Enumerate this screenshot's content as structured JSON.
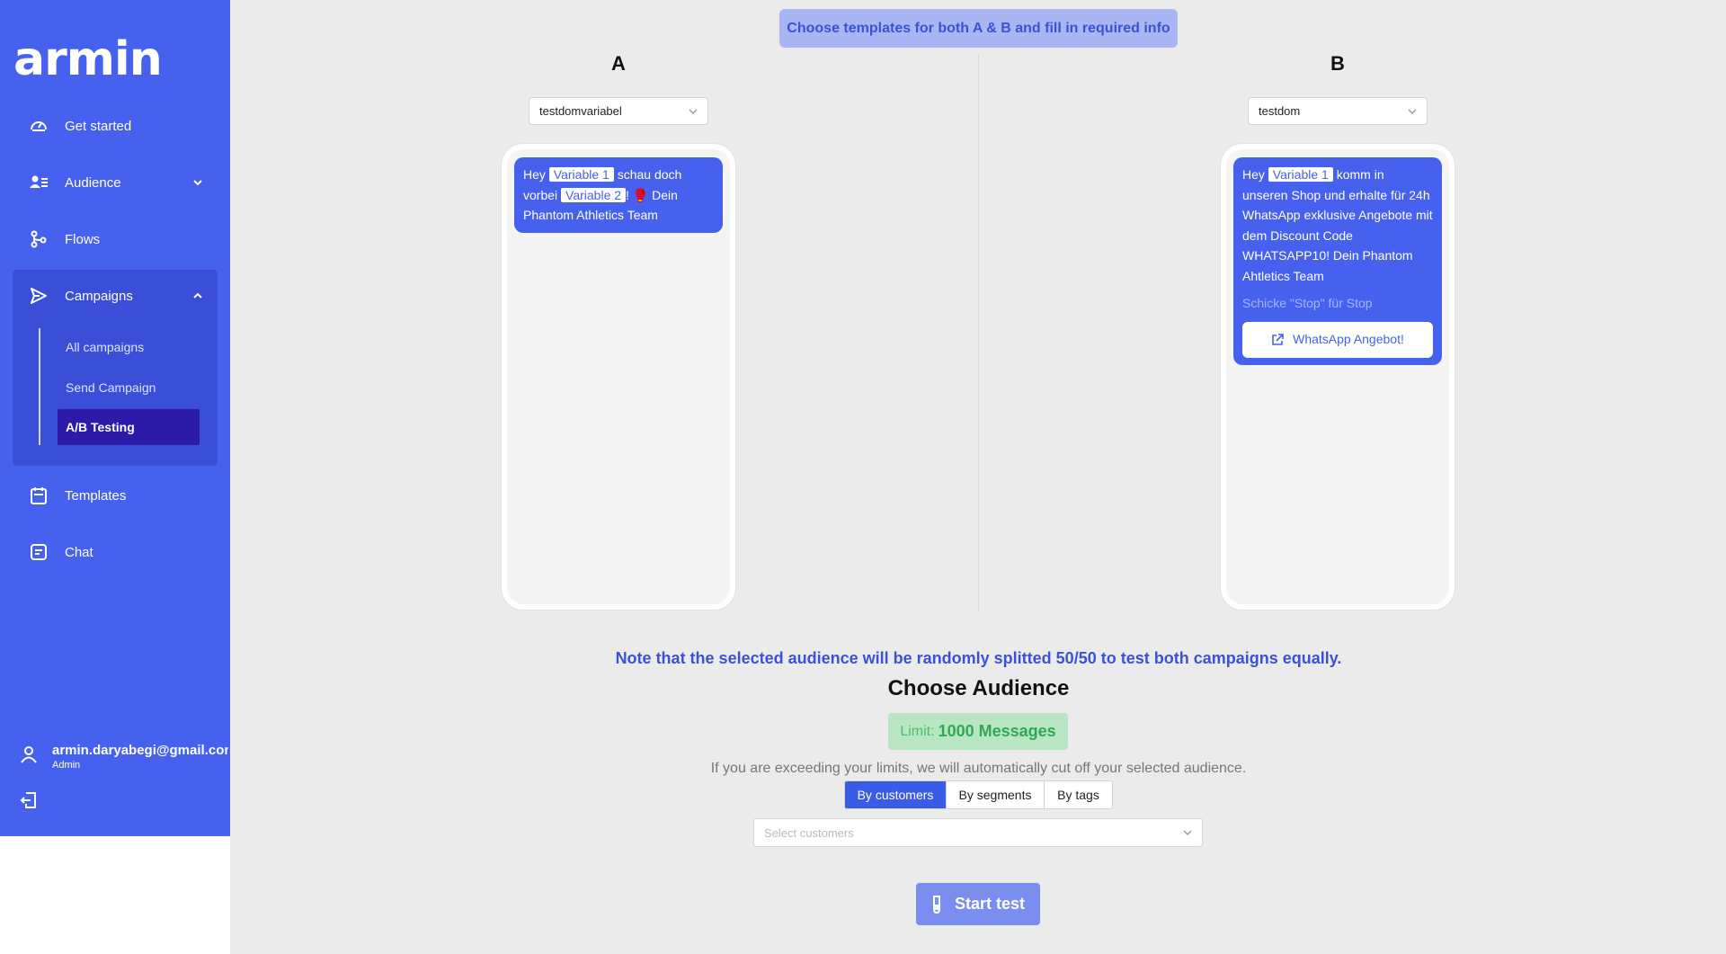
{
  "brand": {
    "logo": "armin",
    "accent": "#4661ee"
  },
  "sidebar": {
    "items": [
      {
        "label": "Get started",
        "icon": "dashboard-icon"
      },
      {
        "label": "Audience",
        "icon": "audience-icon"
      },
      {
        "label": "Flows",
        "icon": "flows-icon"
      },
      {
        "label": "Campaigns",
        "icon": "send-icon"
      },
      {
        "label": "Templates",
        "icon": "calendar-icon"
      },
      {
        "label": "Chat",
        "icon": "chat-icon"
      }
    ],
    "campaign_sub": [
      {
        "label": "All campaigns"
      },
      {
        "label": "Send Campaign"
      },
      {
        "label": "A/B Testing"
      }
    ],
    "user": {
      "email": "armin.daryabegi@gmail.com",
      "role": "Admin"
    }
  },
  "main": {
    "banner": "Choose templates for both A & B and fill in required info",
    "col_a": {
      "title": "A",
      "template": "testdomvariabel",
      "msg": {
        "p1": "Hey ",
        "var1": "Variable 1",
        "p2": " schau doch vorbei ",
        "var2": "Variable 2",
        "p3": "! 🥊 Dein Phantom Athletics Team"
      }
    },
    "col_b": {
      "title": "B",
      "template": "testdom",
      "msg": {
        "p1": "Hey ",
        "var1": "Variable 1",
        "p2": " komm in unseren Shop und erhalte für 24h WhatsApp exklusive Angebote mit dem Discount Code WHATSAPP10! Dein Phantom Ahtletics Team",
        "footer": "Schicke \"Stop\" für Stop",
        "button": "WhatsApp Angebot!"
      }
    },
    "note": "Note that the selected audience will be randomly splitted 50/50 to test both campaigns equally.",
    "choose_title": "Choose Audience",
    "limit": {
      "label": "Limit:",
      "value": "1000 Messages"
    },
    "exceed_text": "If you are exceeding your limits, we will automatically cut off your selected audience.",
    "tabs": [
      "By customers",
      "By segments",
      "By tags"
    ],
    "select_placeholder": "Select customers",
    "start_button": "Start test"
  }
}
